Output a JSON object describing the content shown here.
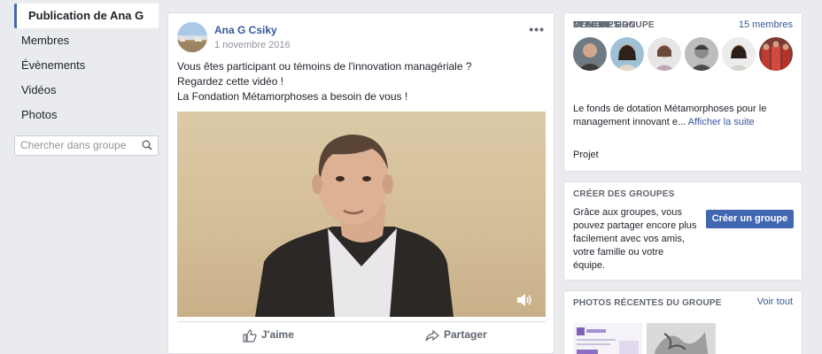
{
  "nav": {
    "items": [
      {
        "label": "Publication de Ana G",
        "active": true
      },
      {
        "label": "Membres"
      },
      {
        "label": "Évènements"
      },
      {
        "label": "Vidéos"
      },
      {
        "label": "Photos"
      }
    ],
    "search_placeholder": "Chercher dans groupe"
  },
  "post": {
    "author": "Ana G Csiky",
    "date": "1 novembre 2016",
    "text_lines": [
      "Vous êtes participant ou témoins de l'innovation managériale ?",
      "Regardez cette vidéo !",
      "La Fondation Métamorphoses a besoin de vous !"
    ],
    "like_label": "J'aime",
    "share_label": "Partager"
  },
  "members": {
    "title": "MEMBRES",
    "count": "15 membres",
    "description_title": "DESCRIPTION",
    "description": "Le fonds de dotation Métamorphoses pour le management innovant e...",
    "description_more": "Afficher la suite",
    "type_title": "TYPE DE GROUPE",
    "type": "Projet"
  },
  "create": {
    "title": "CRÉER DES GROUPES",
    "text": "Grâce aux groupes, vous pouvez partager encore plus facilement avec vos amis, votre famille ou votre équipe.",
    "button": "Créer un groupe"
  },
  "photos": {
    "title": "PHOTOS RÉCENTES DU GROUPE",
    "see_all": "Voir tout"
  },
  "colors": {
    "accent": "#4267b2",
    "link": "#365899",
    "background": "#e9ebee"
  }
}
